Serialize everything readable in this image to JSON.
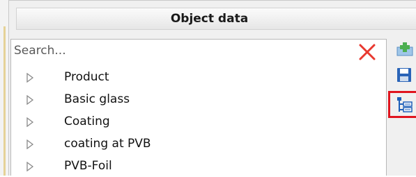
{
  "panel": {
    "title": "Object data"
  },
  "search": {
    "placeholder": "Search...",
    "value": ""
  },
  "tree": {
    "items": [
      {
        "label": "Product"
      },
      {
        "label": "Basic glass"
      },
      {
        "label": "Coating"
      },
      {
        "label": "coating at PVB"
      },
      {
        "label": "PVB-Foil"
      }
    ]
  },
  "toolbar": {
    "tools": [
      {
        "icon": "add-icon"
      },
      {
        "icon": "save-icon"
      },
      {
        "icon": "tree-structure-icon",
        "highlighted": true
      }
    ]
  },
  "colors": {
    "clear_icon": "#e8382f",
    "highlight": "#e0141e",
    "toolbar_icon": "#1e5fb8"
  }
}
